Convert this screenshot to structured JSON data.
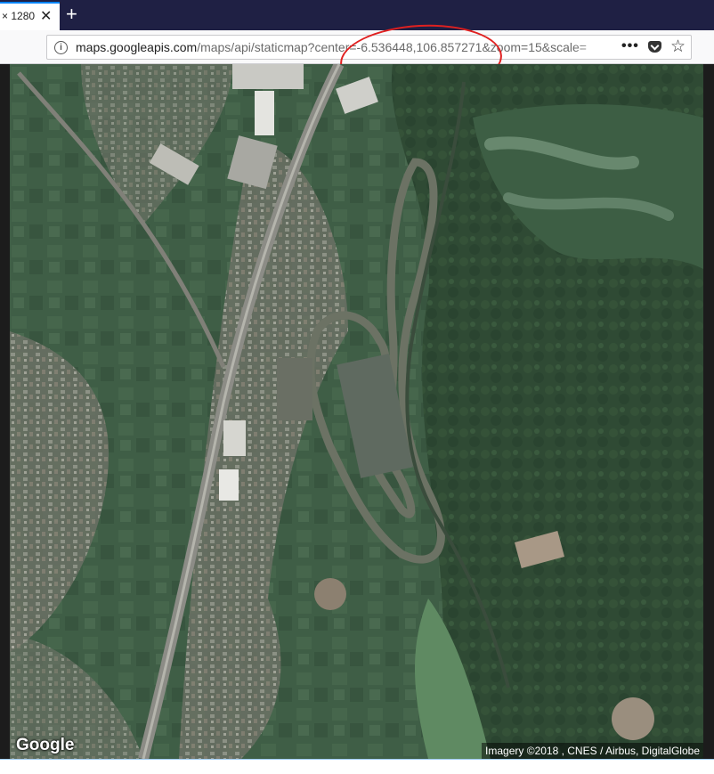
{
  "tab": {
    "title": "× 1280",
    "close_label": "✕",
    "new_tab_label": "+"
  },
  "urlbar": {
    "host": "maps.googleapis.com",
    "path": "/maps/api/staticmap?center=-6.536448,106.857271&zoom=15&scale="
  },
  "map": {
    "logo": "Google",
    "attribution": "Imagery ©2018 , CNES / Airbus, DigitalGlobe"
  },
  "colors": {
    "tabstrip_bg": "#1f2044",
    "tab_accent": "#0a84ff",
    "annotation": "#e02020"
  },
  "icons": [
    "info-icon",
    "close-icon",
    "plus-icon",
    "more-icon",
    "pocket-icon",
    "star-icon"
  ]
}
